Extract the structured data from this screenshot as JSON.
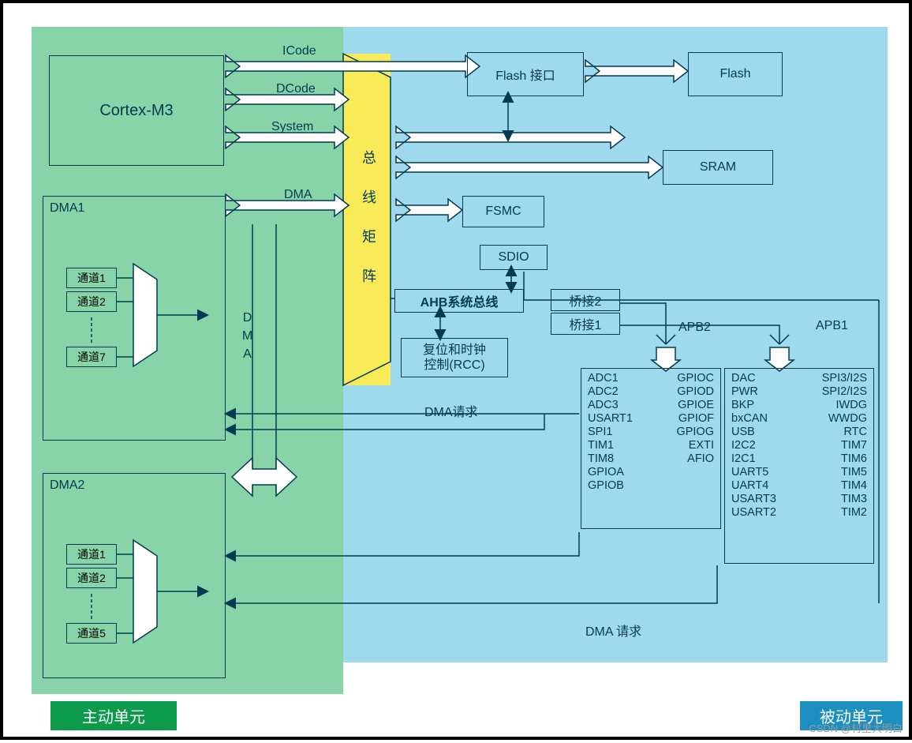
{
  "regions": {
    "active_label": "主动单元",
    "passive_label": "被动单元",
    "matrix_label": "总 线 矩 阵"
  },
  "boxes": {
    "cortex": "Cortex-M3",
    "dma1": "DMA1",
    "dma2": "DMA2",
    "flash_if": "Flash 接口",
    "flash": "Flash",
    "sram": "SRAM",
    "fsmc": "FSMC",
    "sdio": "SDIO",
    "ahb": "AHB系统总线",
    "bridge2": "桥接2",
    "bridge1": "桥接1",
    "rcc": "复位和时钟\n控制(RCC)"
  },
  "labels": {
    "icode": "ICode",
    "dcode": "DCode",
    "system": "System",
    "dma": "DMA",
    "dma_v": "DMA",
    "dmareq1": "DMA请求",
    "dmareq2": "DMA 请求",
    "apb1": "APB1",
    "apb2": "APB2"
  },
  "channels": {
    "c1": "通道1",
    "c2": "通道2",
    "c7": "通道7",
    "c5": "通道5"
  },
  "apb2_periph": {
    "col1": [
      "ADC1",
      "ADC2",
      "ADC3",
      "USART1",
      "SPI1",
      "TIM1",
      "TIM8",
      "GPIOA",
      "GPIOB"
    ],
    "col2": [
      "GPIOC",
      "GPIOD",
      "GPIOE",
      "GPIOF",
      "GPIOG",
      "EXTI",
      "AFIO"
    ]
  },
  "apb1_periph": {
    "col1": [
      "DAC",
      "PWR",
      "BKP",
      "bxCAN",
      "USB",
      "I2C2",
      "I2C1",
      "UART5",
      "UART4",
      "USART3",
      "USART2"
    ],
    "col2": [
      "SPI3/I2S",
      "SPI2/I2S",
      "IWDG",
      "WWDG",
      "RTC",
      "TIM7",
      "TIM6",
      "TIM5",
      "TIM4",
      "TIM3",
      "TIM2"
    ]
  },
  "watermark": "CSDN @村里大明白"
}
